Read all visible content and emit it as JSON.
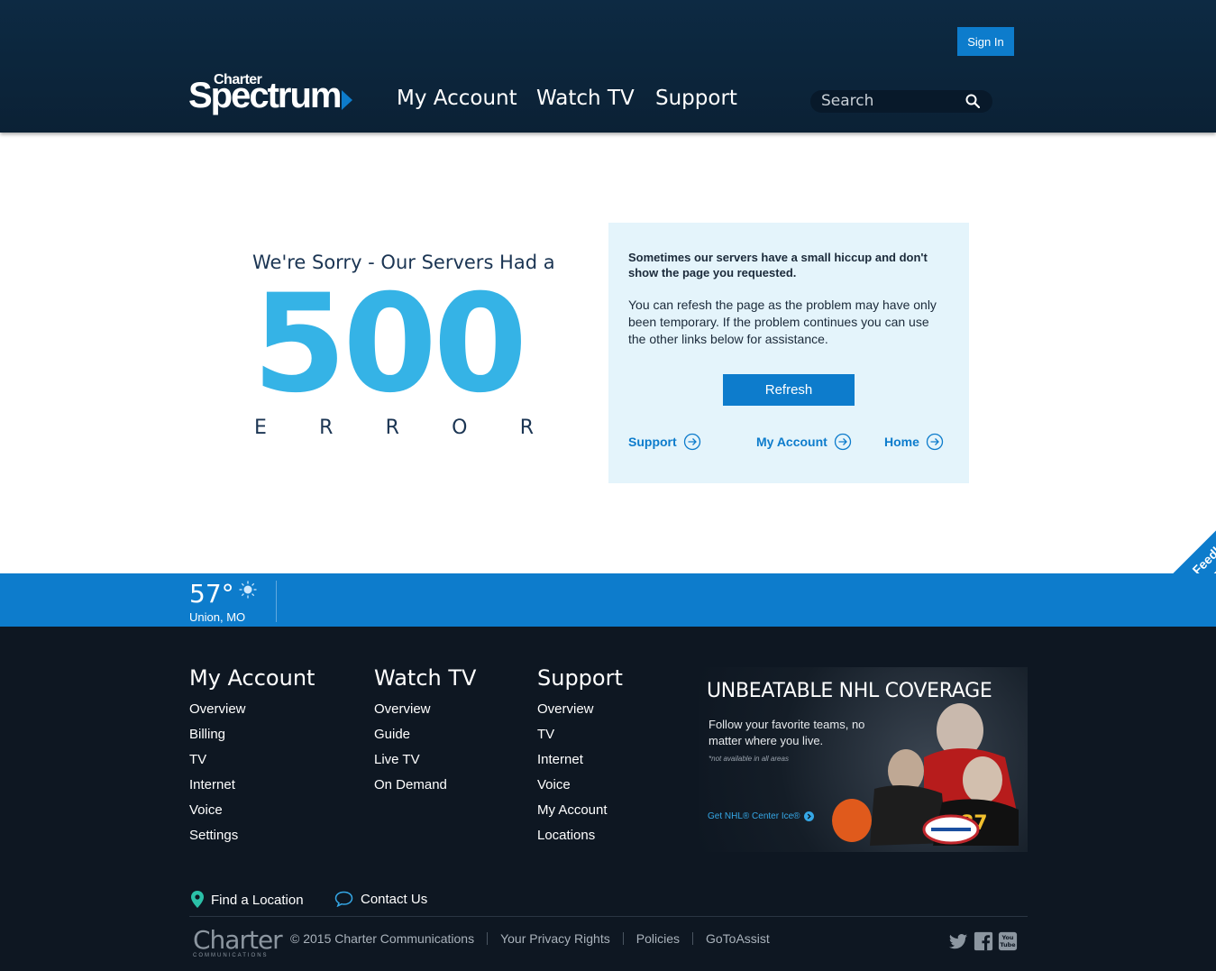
{
  "header": {
    "signin_label": "Sign In",
    "logo_top": "Charter",
    "logo_main": "Spectrum",
    "nav": [
      "My Account",
      "Watch TV",
      "Support"
    ],
    "search_placeholder": "Search"
  },
  "error": {
    "heading": "We're Sorry - Our Servers Had a",
    "code": "500",
    "letters": [
      "E",
      "R",
      "R",
      "O",
      "R"
    ]
  },
  "panel": {
    "bold_text": "Sometimes our servers have a small hiccup and don't show the page you requested.",
    "body_text": "You can refesh the page as the problem may have only been temporary. If the problem continues you can use the other links below for assistance.",
    "refresh_label": "Refresh",
    "links": [
      "Support",
      "My Account",
      "Home"
    ]
  },
  "feedback_label": "Feedback",
  "weather": {
    "temp": "57°",
    "city": "Union, MO"
  },
  "footer": {
    "columns": [
      {
        "heading": "My Account",
        "links": [
          "Overview",
          "Billing",
          "TV",
          "Internet",
          "Voice",
          "Settings"
        ]
      },
      {
        "heading": "Watch TV",
        "links": [
          "Overview",
          "Guide",
          "Live TV",
          "On Demand"
        ]
      },
      {
        "heading": "Support",
        "links": [
          "Overview",
          "TV",
          "Internet",
          "Voice",
          "My Account",
          "Locations"
        ]
      }
    ],
    "promo": {
      "title": "UNBEATABLE NHL COVERAGE",
      "text": "Follow your favorite teams, no matter where you live.",
      "note": "*not available in all areas",
      "link": "Get NHL® Center Ice®"
    },
    "find_location": "Find a Location",
    "contact_us": "Contact Us",
    "charter_logo": "Charter",
    "charter_logo_sub": "COMMUNICATIONS",
    "legal": [
      "© 2015 Charter Communications",
      "Your Privacy Rights",
      "Policies",
      "GoToAssist"
    ]
  },
  "colors": {
    "header_bg": "#0d2a43",
    "accent": "#0d7ccc",
    "big_number": "#35b3e6",
    "panel_bg": "#e4f4fb",
    "footer_bg": "#0e1722"
  }
}
